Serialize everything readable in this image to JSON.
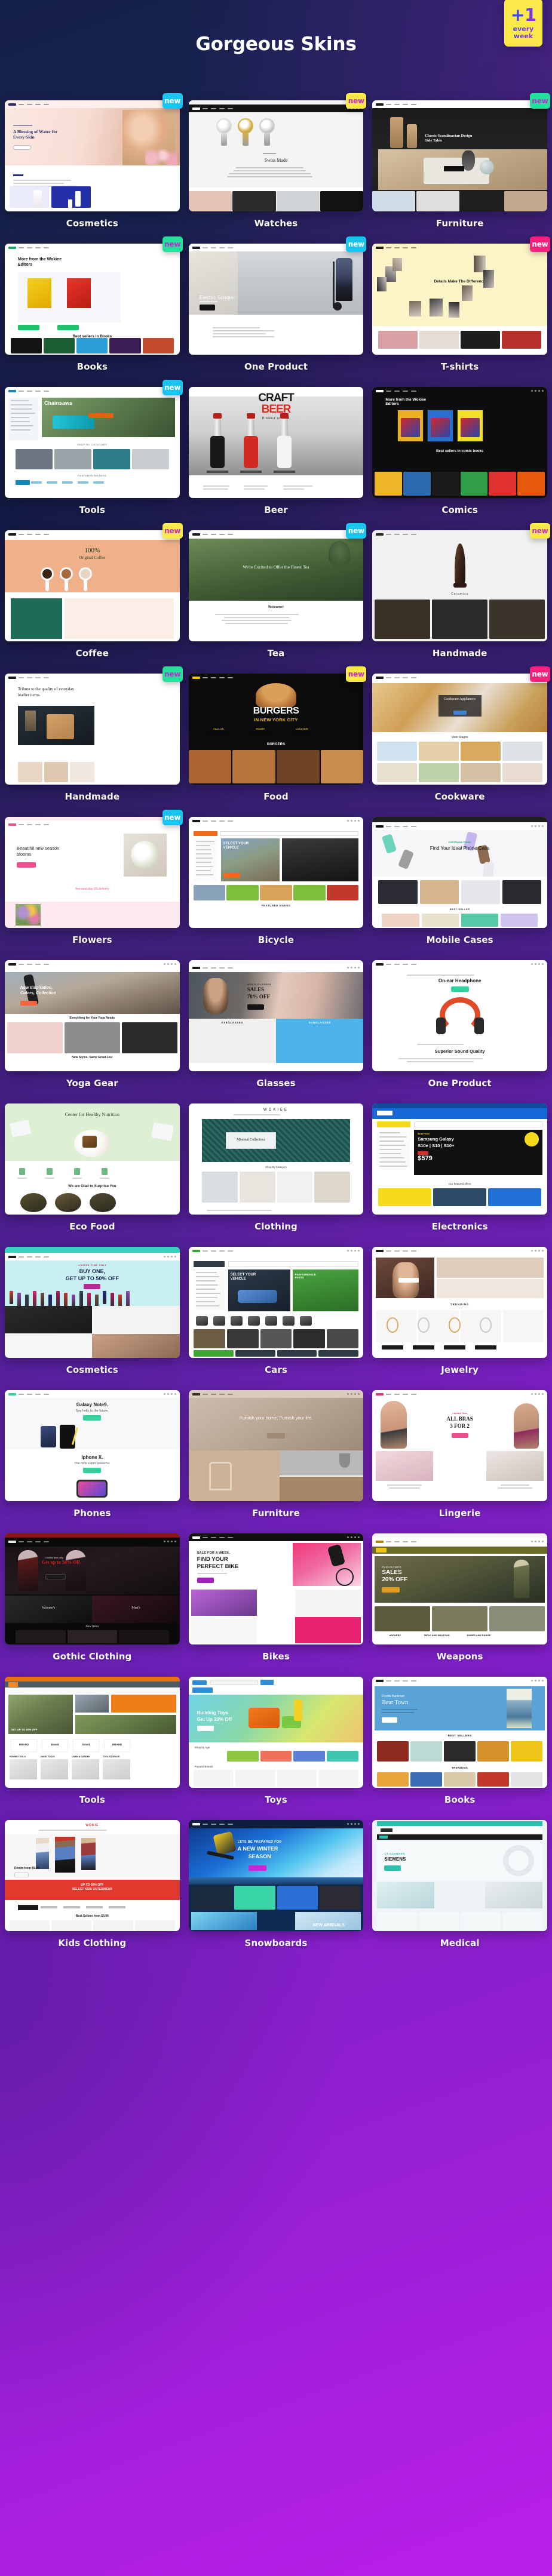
{
  "header": {
    "title": "Gorgeous Skins",
    "badge": {
      "plus_one": "+1",
      "line1": "every",
      "line2": "week"
    }
  },
  "badge_label": "new",
  "colors": {
    "badge_cyan": "#19c5f0",
    "badge_yellow": "#fbe94b",
    "badge_green": "#23e09b",
    "badge_pink": "#f5237e",
    "bg_start": "#15204a",
    "bg_end": "#bb1fe8",
    "label_text": "#ffffff"
  },
  "skins": [
    {
      "label": "Cosmetics",
      "new": true,
      "badge_color": "#19c5f0",
      "theme": "cosmetics1",
      "headline": "A Blessing of Water for Every Skin"
    },
    {
      "label": "Watches",
      "new": true,
      "badge_color": "#fbe94b",
      "theme": "watches",
      "headline": "Swiss Made"
    },
    {
      "label": "Furniture",
      "new": true,
      "badge_color": "#23e09b",
      "theme": "furniture1",
      "headline": "Classic Scandinavian Design Side Table"
    },
    {
      "label": "Books",
      "new": true,
      "badge_color": "#23e09b",
      "theme": "books1",
      "headline": "More from the Wokiee Editors"
    },
    {
      "label": "One Product",
      "new": true,
      "badge_color": "#19c5f0",
      "theme": "scooter",
      "headline": "Electric Scooter"
    },
    {
      "label": "T-shirts",
      "new": true,
      "badge_color": "#f5237e",
      "theme": "tshirts",
      "headline": "Details Make The Difference"
    },
    {
      "label": "Tools",
      "new": true,
      "badge_color": "#19c5f0",
      "theme": "tools1",
      "headline": "Chainsaws"
    },
    {
      "label": "Beer",
      "new": false,
      "badge_color": "",
      "theme": "beer",
      "headline": "CRAFT BEER"
    },
    {
      "label": "Comics",
      "new": false,
      "badge_color": "",
      "theme": "comics",
      "headline": "Best sellers in comic books"
    },
    {
      "label": "Coffee",
      "new": true,
      "badge_color": "#fbe94b",
      "theme": "coffee",
      "headline": "100% Original Coffee"
    },
    {
      "label": "Tea",
      "new": true,
      "badge_color": "#19c5f0",
      "theme": "tea",
      "headline": "We're Excited to Offer the Finest Tea"
    },
    {
      "label": "Handmade",
      "new": true,
      "badge_color": "#fbe94b",
      "theme": "handmade1",
      "headline": "Ceramics"
    },
    {
      "label": "Handmade",
      "new": true,
      "badge_color": "#23e09b",
      "theme": "handmade2",
      "headline": "Tribute to the quality of everyday leather items."
    },
    {
      "label": "Food",
      "new": true,
      "badge_color": "#fbe94b",
      "theme": "food",
      "headline": "BURGERS IN NEW YORK CITY"
    },
    {
      "label": "Cookware",
      "new": true,
      "badge_color": "#f5237e",
      "theme": "cookware",
      "headline": "Cookware Appliances"
    },
    {
      "label": "Flowers",
      "new": true,
      "badge_color": "#19c5f0",
      "theme": "flowers",
      "headline": "Beautiful new season blooms"
    },
    {
      "label": "Bicycle",
      "new": false,
      "badge_color": "",
      "theme": "bicycle",
      "headline": "SELECT YOUR VEHICLE"
    },
    {
      "label": "Mobile Cases",
      "new": false,
      "badge_color": "",
      "theme": "cases",
      "headline": "Find Your Ideal Phone Case"
    },
    {
      "label": "Yoga Gear",
      "new": false,
      "badge_color": "",
      "theme": "yoga",
      "headline": "New Inspiration, Colors, Collection"
    },
    {
      "label": "Glasses",
      "new": false,
      "badge_color": "",
      "theme": "glasses",
      "headline": "SALES 70% OFF"
    },
    {
      "label": "One Product",
      "new": false,
      "badge_color": "",
      "theme": "headphone",
      "headline": "On-ear Headphone"
    },
    {
      "label": "Eco Food",
      "new": false,
      "badge_color": "",
      "theme": "ecofood",
      "headline": "Center for Healthy Nutrition"
    },
    {
      "label": "Clothing",
      "new": false,
      "badge_color": "",
      "theme": "clothing",
      "headline": "Minimal Collection"
    },
    {
      "label": "Electronics",
      "new": false,
      "badge_color": "",
      "theme": "electronics",
      "headline": "Samsung Galaxy S10e | S10 | S10+ $579"
    },
    {
      "label": "Cosmetics",
      "new": false,
      "badge_color": "",
      "theme": "cosmetics2",
      "headline": "BUY ONE, GET UP TO 50% OFF"
    },
    {
      "label": "Cars",
      "new": false,
      "badge_color": "",
      "theme": "cars",
      "headline": "SELECT YOUR VEHICLE"
    },
    {
      "label": "Jewelry",
      "new": false,
      "badge_color": "",
      "theme": "jewelry",
      "headline": "TRENDING"
    },
    {
      "label": "Phones",
      "new": false,
      "badge_color": "",
      "theme": "phones",
      "headline": "Galaxy Note9. Say hello to the future."
    },
    {
      "label": "Furniture",
      "new": false,
      "badge_color": "",
      "theme": "furniture2",
      "headline": "Furnish your home, Furnish your life."
    },
    {
      "label": "Lingerie",
      "new": false,
      "badge_color": "",
      "theme": "lingerie",
      "headline": "ALL BRAS 3 FOR 2"
    },
    {
      "label": "Gothic Clothing",
      "new": false,
      "badge_color": "",
      "theme": "gothic",
      "headline": "Get up to 50% Off"
    },
    {
      "label": "Bikes",
      "new": false,
      "badge_color": "",
      "theme": "bikes",
      "headline": "SALE FOR A WEEK. FIND YOUR PERFECT BIKE"
    },
    {
      "label": "Weapons",
      "new": false,
      "badge_color": "",
      "theme": "weapons",
      "headline": "CLEARANCE SALES 20% OFF"
    },
    {
      "label": "Tools",
      "new": false,
      "badge_color": "",
      "theme": "tools2",
      "headline": "GET UP TO 50% OFF"
    },
    {
      "label": "Toys",
      "new": false,
      "badge_color": "",
      "theme": "toys",
      "headline": "Building Toys Get Up 20% Off"
    },
    {
      "label": "Books",
      "new": false,
      "badge_color": "",
      "theme": "books2",
      "headline": "Bear Town"
    },
    {
      "label": "Kids Clothing",
      "new": false,
      "badge_color": "",
      "theme": "kids",
      "headline": "UP TO 30% OFF SELECT KIDS OUTERWEAR"
    },
    {
      "label": "Snowboards",
      "new": false,
      "badge_color": "",
      "theme": "snow",
      "headline": "LETS BE PREPARED FOR A NEW WINTER SEASON"
    },
    {
      "label": "Medical",
      "new": false,
      "badge_color": "",
      "theme": "medical",
      "headline": "CT SCANNER SIEMENS"
    }
  ]
}
